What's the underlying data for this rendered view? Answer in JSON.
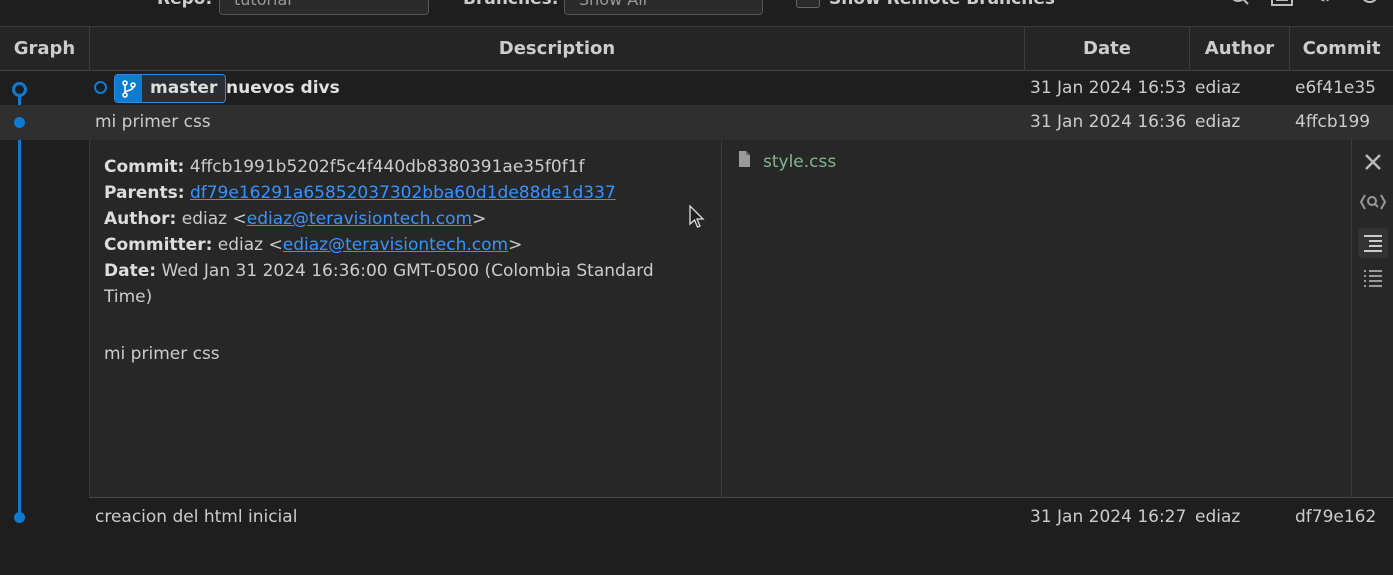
{
  "toolbar": {
    "repo_label": "Repo:",
    "repo_value": "tutorial",
    "branches_label": "Branches:",
    "branches_value": "Show All",
    "remote_label": "Show Remote Branches",
    "icons": [
      "search-icon",
      "terminal-icon",
      "gear-icon",
      "refresh-icon"
    ]
  },
  "columns": {
    "graph": "Graph",
    "description": "Description",
    "date": "Date",
    "author": "Author",
    "commit": "Commit"
  },
  "commits": [
    {
      "branch": "master",
      "message": "nuevos divs",
      "date": "31 Jan 2024 16:53",
      "author": "ediaz",
      "hash": "e6f41e35"
    },
    {
      "message": "mi primer css",
      "date": "31 Jan 2024 16:36",
      "author": "ediaz",
      "hash": "4ffcb199"
    },
    {
      "message": "creacion del html inicial",
      "date": "31 Jan 2024 16:27",
      "author": "ediaz",
      "hash": "df79e162"
    }
  ],
  "details": {
    "commit_label": "Commit:",
    "commit_value": "4ffcb1991b5202f5c4f440db8380391ae35f0f1f",
    "parents_label": "Parents:",
    "parents_value": "df79e16291a65852037302bba60d1de88de1d337",
    "author_label": "Author:",
    "author_name": "ediaz <",
    "author_email": "ediaz@teravisiontech.com",
    "author_close": ">",
    "committer_label": "Committer:",
    "committer_name": "ediaz <",
    "committer_email": "ediaz@teravisiontech.com",
    "committer_close": ">",
    "date_label": "Date:",
    "date_value": "Wed Jan 31 2024 16:36:00 GMT-0500 (Colombia Standard Time)",
    "message": "mi primer css",
    "files": [
      "style.css"
    ]
  },
  "colors": {
    "graph": "#0e7ad0",
    "link": "#3794ff",
    "file_added": "#81b88b"
  }
}
